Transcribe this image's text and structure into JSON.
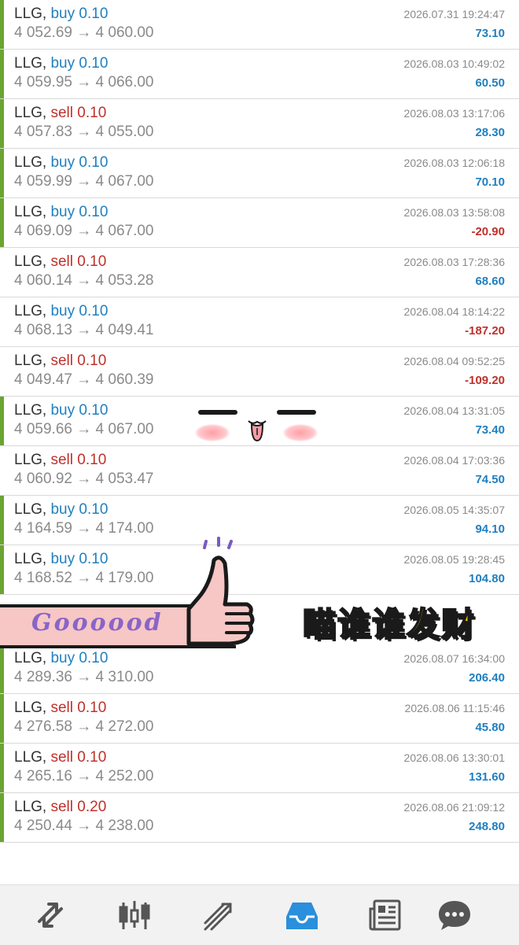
{
  "trades": [
    {
      "symbol": "LLG,",
      "side": "buy",
      "volume": "0.10",
      "open_price": "4 052.69",
      "close_price": "4 060.00",
      "time": "2026.07.31 19:24:47",
      "profit": "73.10",
      "bar_color": "#6aa531"
    },
    {
      "symbol": "LLG,",
      "side": "buy",
      "volume": "0.10",
      "open_price": "4 059.95",
      "close_price": "4 066.00",
      "time": "2026.08.03 10:49:02",
      "profit": "60.50",
      "bar_color": "#6aa531"
    },
    {
      "symbol": "LLG,",
      "side": "sell",
      "volume": "0.10",
      "open_price": "4 057.83",
      "close_price": "4 055.00",
      "time": "2026.08.03 13:17:06",
      "profit": "28.30",
      "bar_color": "#6aa531"
    },
    {
      "symbol": "LLG,",
      "side": "buy",
      "volume": "0.10",
      "open_price": "4 059.99",
      "close_price": "4 067.00",
      "time": "2026.08.03 12:06:18",
      "profit": "70.10",
      "bar_color": "#6aa531"
    },
    {
      "symbol": "LLG,",
      "side": "buy",
      "volume": "0.10",
      "open_price": "4 069.09",
      "close_price": "4 067.00",
      "time": "2026.08.03 13:58:08",
      "profit": "-20.90",
      "bar_color": "#6aa531"
    },
    {
      "symbol": "LLG,",
      "side": "sell",
      "volume": "0.10",
      "open_price": "4 060.14",
      "close_price": "4 053.28",
      "time": "2026.08.03 17:28:36",
      "profit": "68.60",
      "bar_color": "#ffffff"
    },
    {
      "symbol": "LLG,",
      "side": "buy",
      "volume": "0.10",
      "open_price": "4 068.13",
      "close_price": "4 049.41",
      "time": "2026.08.04 18:14:22",
      "profit": "-187.20",
      "bar_color": "#ffffff"
    },
    {
      "symbol": "LLG,",
      "side": "sell",
      "volume": "0.10",
      "open_price": "4 049.47",
      "close_price": "4 060.39",
      "time": "2026.08.04 09:52:25",
      "profit": "-109.20",
      "bar_color": "#ffffff"
    },
    {
      "symbol": "LLG,",
      "side": "buy",
      "volume": "0.10",
      "open_price": "4 059.66",
      "close_price": "4 067.00",
      "time": "2026.08.04 13:31:05",
      "profit": "73.40",
      "bar_color": "#6aa531"
    },
    {
      "symbol": "LLG,",
      "side": "sell",
      "volume": "0.10",
      "open_price": "4 060.92",
      "close_price": "4 053.47",
      "time": "2026.08.04 17:03:36",
      "profit": "74.50",
      "bar_color": "#ffffff"
    },
    {
      "symbol": "LLG,",
      "side": "buy",
      "volume": "0.10",
      "open_price": "4 164.59",
      "close_price": "4 174.00",
      "time": "2026.08.05 14:35:07",
      "profit": "94.10",
      "bar_color": "#6aa531"
    },
    {
      "symbol": "LLG,",
      "side": "buy",
      "volume": "0.10",
      "open_price": "4 168.52",
      "close_price": "4 179.00",
      "time": "2026.08.05 19:28:45",
      "profit": "104.80",
      "bar_color": "#6aa531"
    },
    {
      "hidden": true
    },
    {
      "symbol": "LLG,",
      "side": "buy",
      "volume": "0.10",
      "open_price": "4 289.36",
      "close_price": "4 310.00",
      "time": "2026.08.07 16:34:00",
      "profit": "206.40",
      "bar_color": "#6aa531"
    },
    {
      "symbol": "LLG,",
      "side": "sell",
      "volume": "0.10",
      "open_price": "4 276.58",
      "close_price": "4 272.00",
      "time": "2026.08.06 11:15:46",
      "profit": "45.80",
      "bar_color": "#6aa531"
    },
    {
      "symbol": "LLG,",
      "side": "sell",
      "volume": "0.10",
      "open_price": "4 265.16",
      "close_price": "4 252.00",
      "time": "2026.08.06 13:30:01",
      "profit": "131.60",
      "bar_color": "#6aa531"
    },
    {
      "symbol": "LLG,",
      "side": "sell",
      "volume": "0.20",
      "open_price": "4 250.44",
      "close_price": "4 238.00",
      "time": "2026.08.06 21:09:12",
      "profit": "248.80",
      "bar_color": "#6aa531"
    }
  ],
  "arrow": "→",
  "sticker": {
    "good_text": "Goooood",
    "chinese_text": "瞄谁谁发财"
  },
  "colors": {
    "buy": "#1f7fc0",
    "sell": "#c0302b",
    "profit_positive": "#1f7fc0",
    "profit_negative": "#c0302b",
    "accent_active": "#2a8fdc",
    "nav_icon": "#555555"
  },
  "nav": {
    "items": [
      {
        "name": "quotes-icon",
        "active": false
      },
      {
        "name": "chart-candles-icon",
        "active": false
      },
      {
        "name": "trade-icon",
        "active": false
      },
      {
        "name": "history-inbox-icon",
        "active": true
      },
      {
        "name": "news-icon",
        "active": false
      },
      {
        "name": "messages-icon",
        "active": false
      }
    ]
  }
}
